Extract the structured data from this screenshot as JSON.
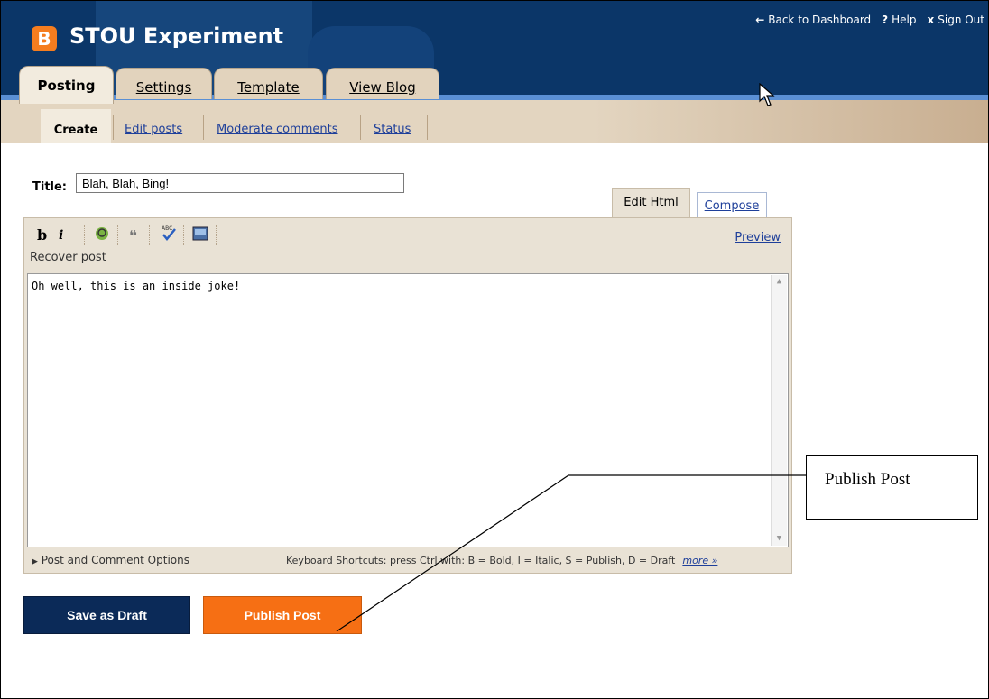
{
  "header": {
    "logo_glyph": "B",
    "app_title": "STOU Experiment",
    "back_label": "Back to Dashboard",
    "back_icon": "arrow-left",
    "help_label": "Help",
    "help_icon": "?",
    "signout_label": "Sign Out",
    "signout_icon": "x"
  },
  "tabs": [
    "Posting",
    "Settings",
    "Template",
    "View Blog"
  ],
  "subnav": [
    "Create",
    "Edit posts",
    "Moderate comments",
    "Status"
  ],
  "post": {
    "title_label": "Title:",
    "title_value": "Blah, Blah, Bing!",
    "mode_tabs": [
      "Edit Html",
      "Compose"
    ],
    "toolbar": {
      "bold": "b",
      "italic": "i",
      "preview_label": "Preview"
    },
    "recover_label": "Recover post",
    "body_text": "Oh well, this is an inside joke!",
    "options_label": "Post and Comment Options",
    "shortcuts_text": "Keyboard Shortcuts: press Ctrl with: B = Bold, I = Italic, S = Publish, D = Draft",
    "more_label": "more »"
  },
  "buttons": {
    "save_draft": "Save as Draft",
    "publish": "Publish Post"
  },
  "callout": {
    "text": "Publish Post"
  },
  "colors": {
    "header": "#0b3668",
    "accent": "#f66f14",
    "tan": "#e3d5c0"
  }
}
